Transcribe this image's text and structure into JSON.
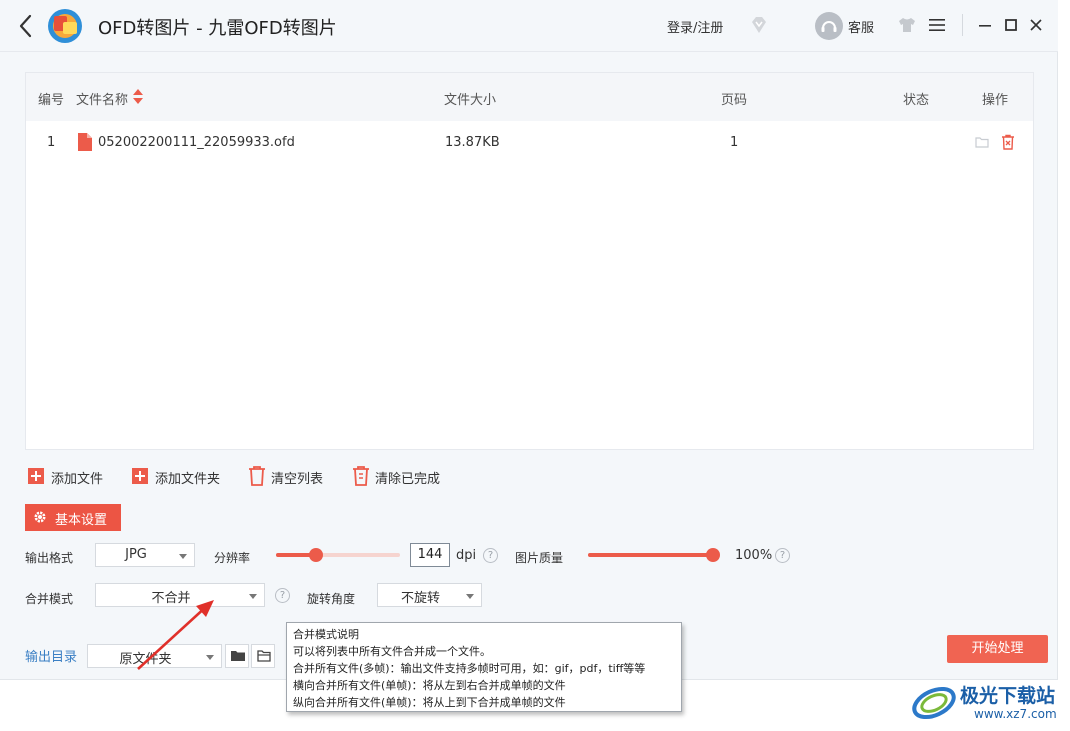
{
  "titlebar": {
    "title": "OFD转图片 - 九雷OFD转图片",
    "login": "登录/注册",
    "service": "客服"
  },
  "table": {
    "columns": [
      "编号",
      "文件名称",
      "文件大小",
      "页码",
      "状态",
      "操作"
    ],
    "rows": [
      {
        "index": "1",
        "name": "052002200111_22059933.ofd",
        "size": "13.87KB",
        "pages": "1",
        "status": ""
      }
    ]
  },
  "toolbar": {
    "add_file": "添加文件",
    "add_folder": "添加文件夹",
    "clear_list": "清空列表",
    "clear_done": "清除已完成"
  },
  "settings": {
    "basic_label": "基本设置",
    "output_format_label": "输出格式",
    "output_format_value": "JPG",
    "resolution_label": "分辨率",
    "resolution_value": "144",
    "resolution_unit": "dpi",
    "resolution_fraction": 0.3,
    "quality_label": "图片质量",
    "quality_value": "100%",
    "quality_fraction": 1.0,
    "merge_label": "合并模式",
    "merge_value": "不合并",
    "rotate_label": "旋转角度",
    "rotate_value": "不旋转",
    "output_dir_label": "输出目录",
    "output_dir_value": "原文件夹"
  },
  "start_button": "开始处理",
  "tooltip": {
    "lines": [
      "合并模式说明",
      "可以将列表中所有文件合并成一个文件。",
      "合并所有文件(多帧)：输出文件支持多帧时可用，如：gif，pdf，tiff等等",
      "横向合并所有文件(单帧)：将从左到右合并成单帧的文件",
      "纵向合并所有文件(单帧)：将从上到下合并成单帧的文件"
    ]
  },
  "watermark": {
    "text": "极光下载站",
    "url": "www.xz7.com"
  },
  "colors": {
    "accent": "#ec5544",
    "link": "#3a7fc4"
  }
}
